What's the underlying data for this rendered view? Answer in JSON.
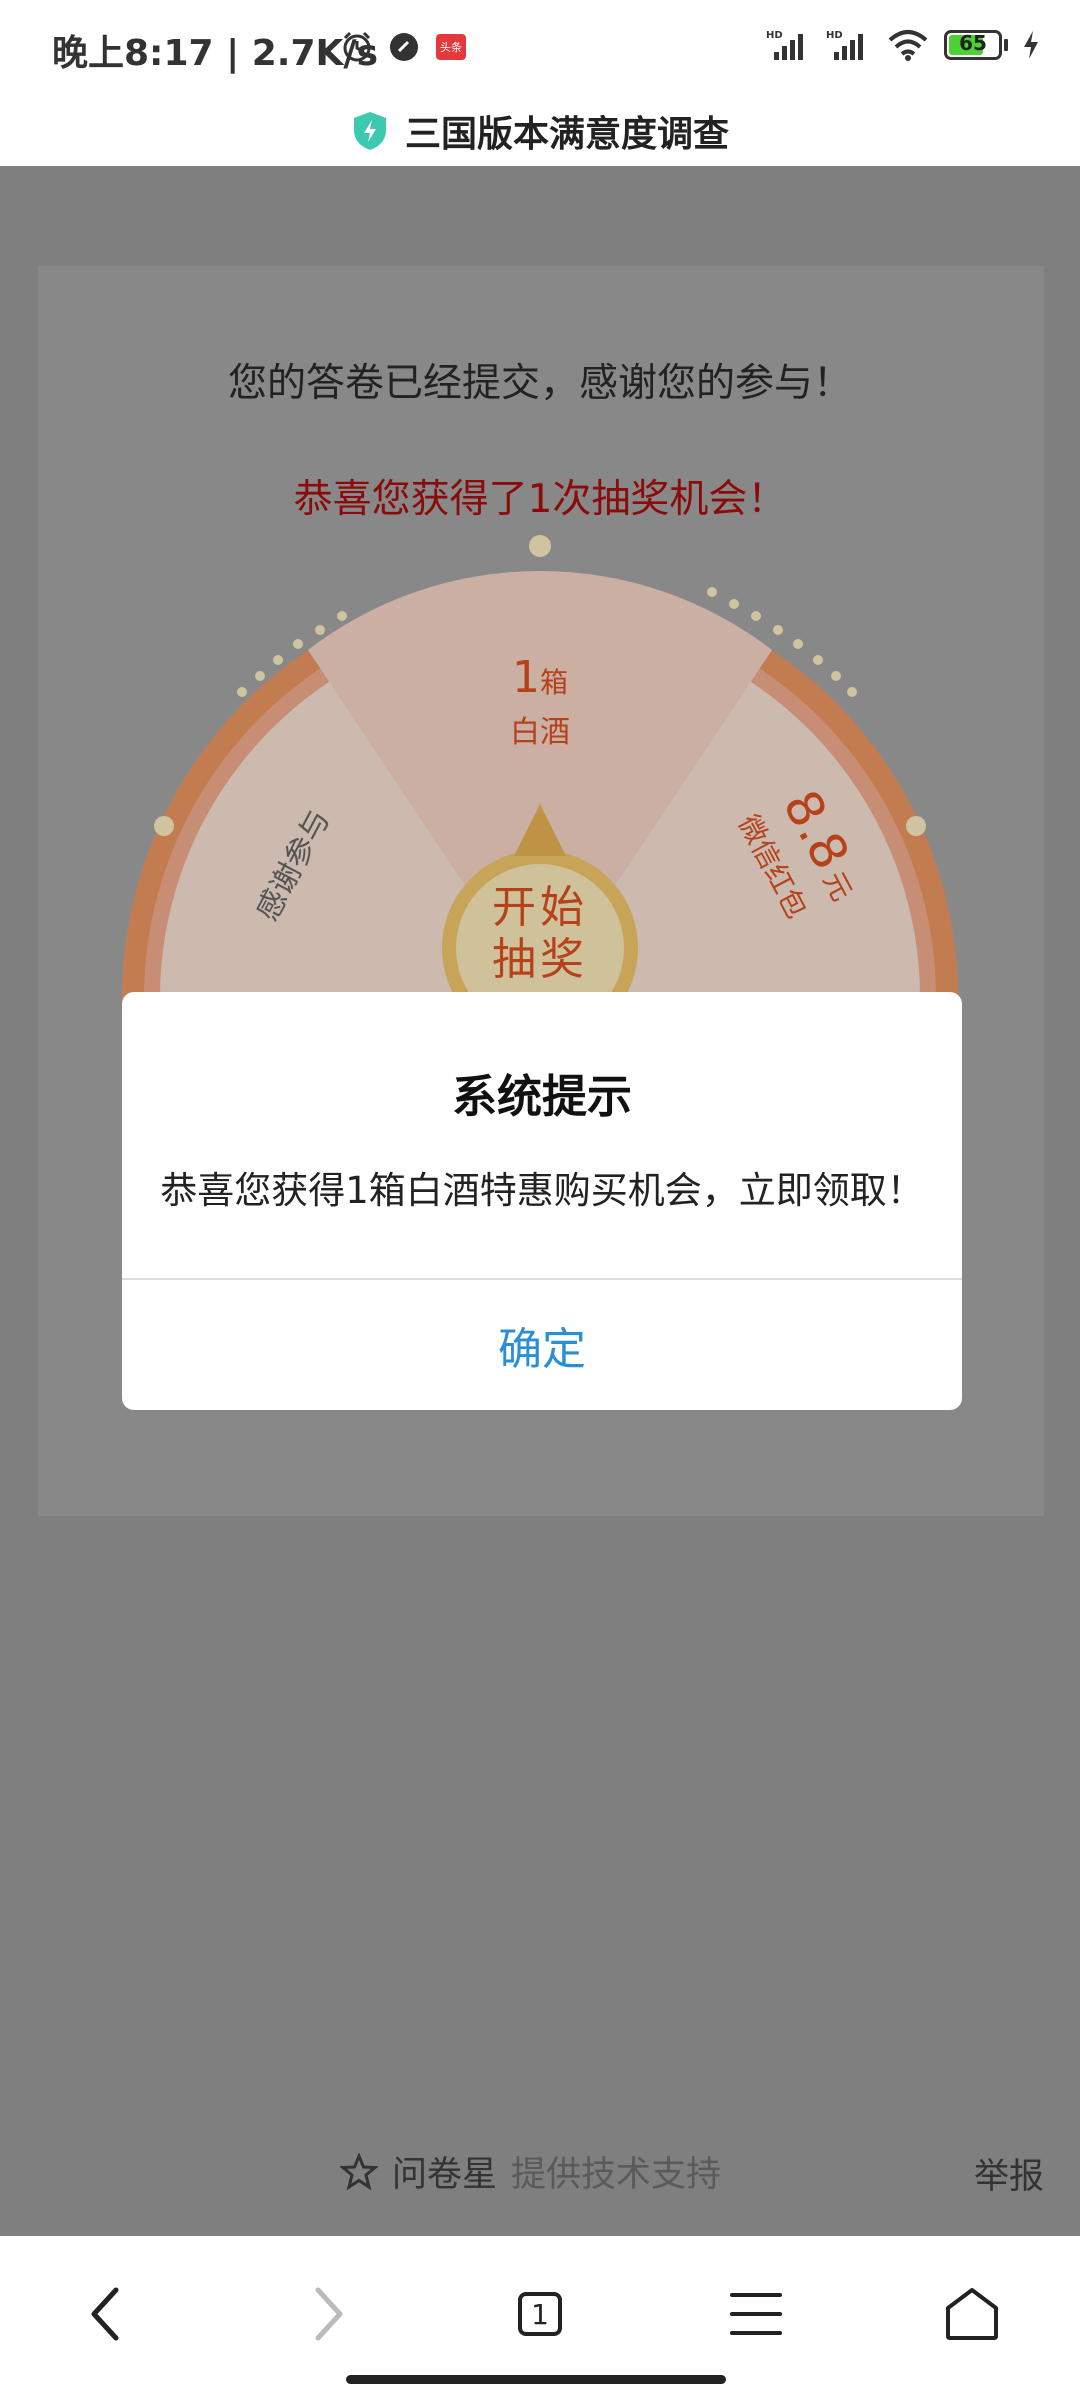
{
  "status_bar": {
    "time": "晚上8:17 | 2.7K/s",
    "battery": "65",
    "icons": [
      "alarm-icon",
      "app-icon",
      "toutiao-icon",
      "hd-signal-icon",
      "hd-signal-icon",
      "wifi-icon",
      "battery-icon",
      "charging-icon"
    ],
    "toutiao_label": "头条"
  },
  "header": {
    "title": "三国版本满意度调查"
  },
  "page": {
    "submitted_message": "您的答卷已经提交，感谢您的参与！",
    "chance_message": "恭喜您获得了1次抽奖机会！"
  },
  "wheel": {
    "prize_top_num": "1",
    "prize_top_unit": "箱",
    "prize_top_name": "白酒",
    "prize_left": "感谢参与",
    "prize_right_amount": "8.8",
    "prize_right_unit": "元",
    "prize_right_name": "微信红包",
    "start_button": "开始抽奖"
  },
  "dialog": {
    "title": "系统提示",
    "message": "恭喜您获得1箱白酒特惠购买机会，立即领取！",
    "confirm_label": "确定"
  },
  "footer": {
    "brand": "问卷星",
    "support": "提供技术支持",
    "report": "举报"
  },
  "bottom_nav": {
    "tab_count": "1"
  },
  "colors": {
    "accent_blue": "#2b8fd8",
    "chance_red": "#8b0a0a",
    "wheel_orange": "#e8742e"
  }
}
